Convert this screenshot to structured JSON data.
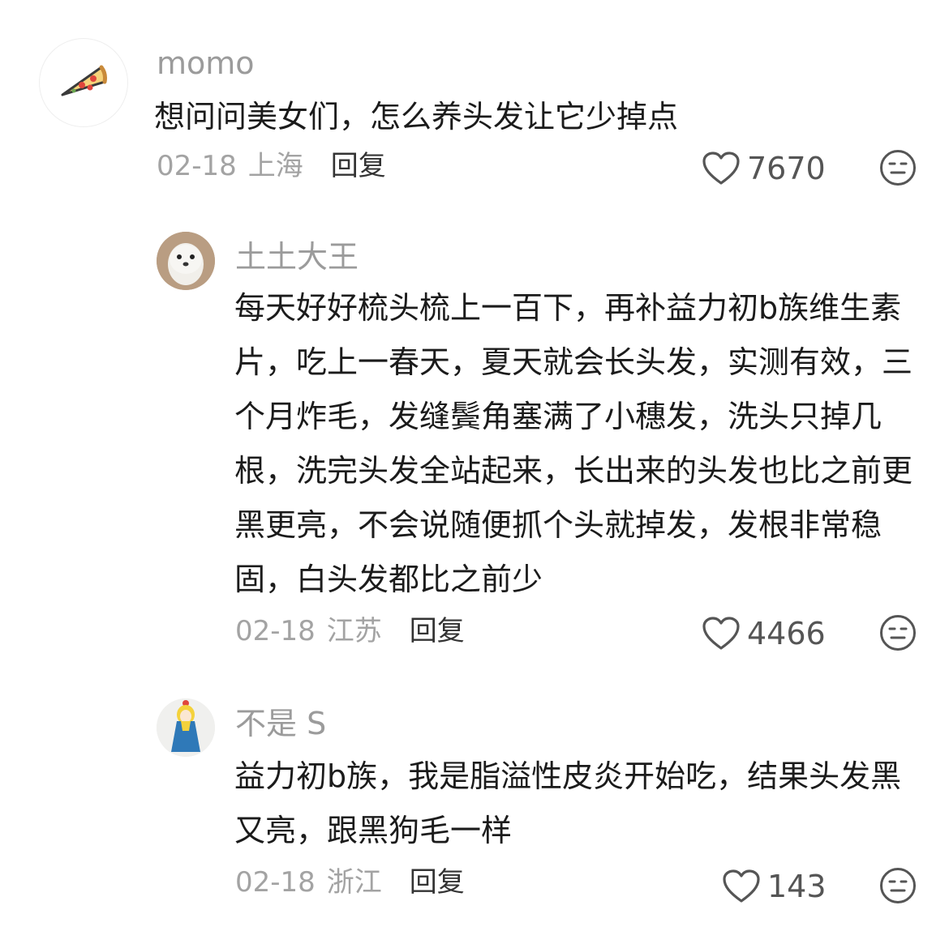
{
  "comments": [
    {
      "username": "momo",
      "avatar_icon": "pizza-icon",
      "text": "想问问美女们，怎么养头发让它少掉点",
      "date": "02-18",
      "location": "上海",
      "reply_label": "回复",
      "likes": "7670",
      "dislike_icon": "meh-face-icon"
    },
    {
      "username": "土土大王",
      "avatar_icon": "seal-icon",
      "text": "每天好好梳头梳上一百下，再补益力初b族维生素片，吃上一春天，夏天就会长头发，实测有效，三个月炸毛，发缝鬓角塞满了小穗发，洗头只掉几根，洗完头发全站起来，长出来的头发也比之前更黑更亮，不会说随便抓个头就掉发，发根非常稳固，白头发都比之前少",
      "date": "02-18",
      "location": "江苏",
      "reply_label": "回复",
      "likes": "4466",
      "dislike_icon": "meh-face-icon"
    },
    {
      "username": "不是 S",
      "avatar_icon": "girl-drawing-icon",
      "text": "益力初b族，我是脂溢性皮炎开始吃，结果头发黑又亮，跟黑狗毛一样",
      "date": "02-18",
      "location": "浙江",
      "reply_label": "回复",
      "likes": "143",
      "dislike_icon": "meh-face-icon"
    }
  ],
  "colors": {
    "username": "#9b9b9b",
    "text": "#1b1b1b",
    "meta": "#a3a3a3",
    "reply": "#333333",
    "icon": "#555555"
  }
}
